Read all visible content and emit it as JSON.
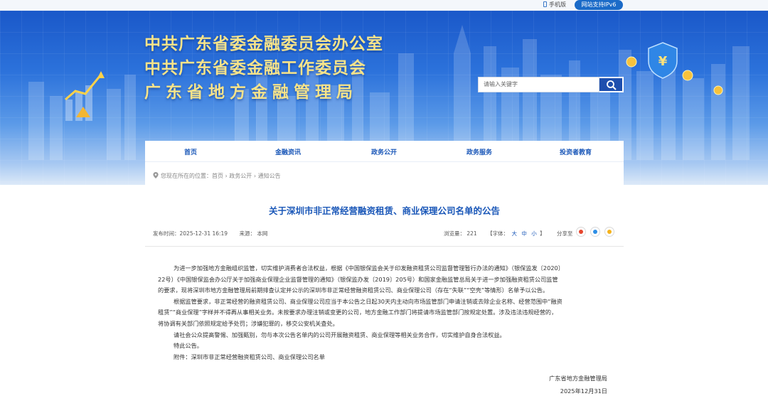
{
  "topbar": {
    "mobile_label": "手机版",
    "ipv6_label": "网站支持IPv6"
  },
  "header": {
    "titles": [
      "中共广东省委金融委员会办公室",
      "中共广东省委金融工作委员会",
      "广东省地方金融管理局"
    ],
    "search_placeholder": "请输入关键字"
  },
  "nav": {
    "items": [
      "首页",
      "金融资讯",
      "政务公开",
      "政务服务",
      "投资者教育"
    ]
  },
  "breadcrumb": {
    "label": "您现在所在的位置：首页 › 政务公开 › 通知公告"
  },
  "article": {
    "title": "关于深圳市非正常经营融资租赁、商业保理公司名单的公告",
    "published": "发布时间：2025-12-31 16:19",
    "source": "来源：  本网",
    "views": "浏览量：  221",
    "font_label": "【字体：",
    "font_sizes": [
      "大",
      "中",
      "小"
    ],
    "font_end": "】",
    "share_label": "分享至",
    "paragraphs": [
      "为进一步加强地方金融组织监管，切实维护消费者合法权益，根据《中国银保监会关于印发融资租赁公司监督管理暂行办法的通知》（银保监发〔2020〕",
      "22号）《中国银保监会办公厅关于加强商业保理企业监督管理的通知》（银保监办发〔2019〕205号）和国家金融监管总局关于进一步加强融资租赁公司监管",
      "的要求，现将深圳市地方金融管理局前期排查认定并公示的深圳市非正常经营融资租赁公司、商业保理公司（存在“失联”“空壳”等情形）名单予以公告。",
      "根据监管要求，非正常经营的融资租赁公司、商业保理公司应当于本公告之日起30天内主动向市场监管部门申请注销或去除企业名称、经营范围中“融资",
      "租赁”“商业保理”字样并不得再从事相关业务。未按要求办理注销或变更的公司，地方金融工作部门将提请市场监管部门按规定处置。涉及违法违规经营的，",
      "将协调有关部门依照规定给予处罚；涉嫌犯罪的，移交公安机关查处。",
      "请社会公众提高警惕、加强甄别，勿与本次公告名单内的公司开展融资租赁、商业保理等相关业务合作，切实维护自身合法权益。",
      "特此公告。",
      "附件：深圳市非正常经营融资租赁公司、商业保理公司名单"
    ],
    "signature": "广东省地方金融管理局",
    "date": "2025年12月31日"
  },
  "colors": {
    "accent": "#1a57b8",
    "title_gold": "#f6e38a",
    "banner_blue": "#1a58c9"
  }
}
